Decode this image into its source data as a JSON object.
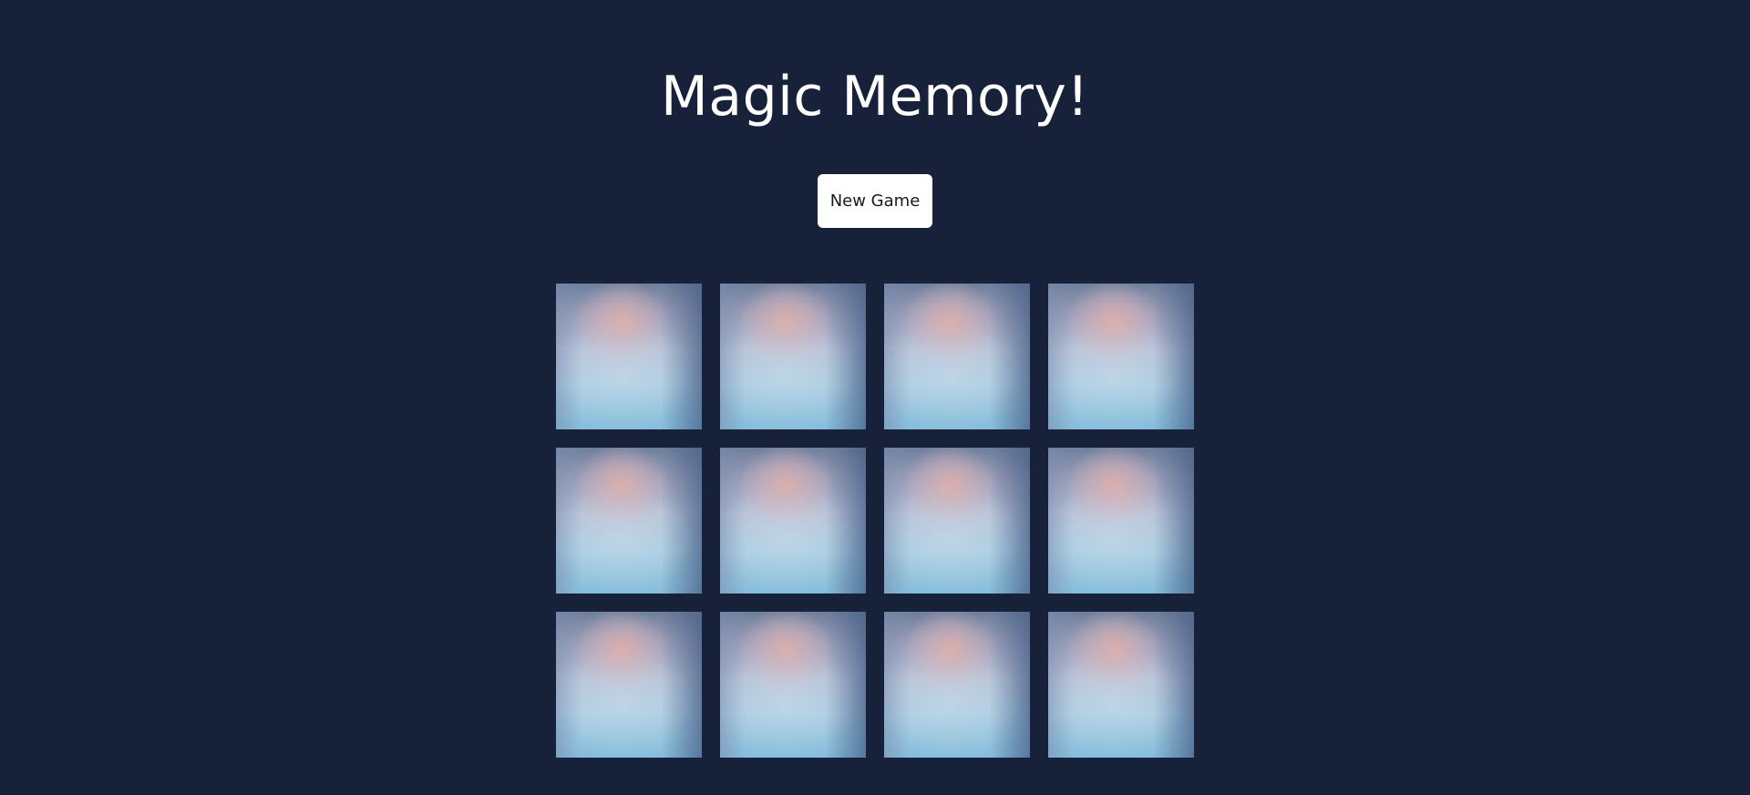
{
  "game": {
    "title": "Magic Memory!",
    "new_game_label": "New Game"
  },
  "colors": {
    "background": "#17223a",
    "title_text": "#ffffff",
    "button_background": "#ffffff",
    "button_text": "#1a1a1a"
  },
  "board": {
    "columns": 4,
    "rows": 3,
    "cards": [
      {
        "state": "face-down"
      },
      {
        "state": "face-down"
      },
      {
        "state": "face-down"
      },
      {
        "state": "face-down"
      },
      {
        "state": "face-down"
      },
      {
        "state": "face-down"
      },
      {
        "state": "face-down"
      },
      {
        "state": "face-down"
      },
      {
        "state": "face-down"
      },
      {
        "state": "face-down"
      },
      {
        "state": "face-down"
      },
      {
        "state": "face-down"
      }
    ]
  }
}
